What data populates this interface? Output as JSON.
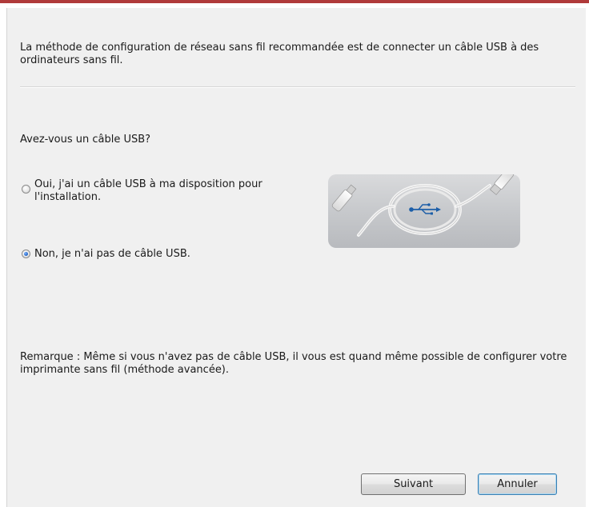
{
  "dialog": {
    "intro_text": "La méthode de configuration de réseau sans fil recommandée est de connecter un câble USB à des ordinateurs sans fil.",
    "question": "Avez-vous un câble USB?",
    "options": [
      {
        "label": "Oui, j'ai un câble USB à ma disposition pour l'installation.",
        "selected": false
      },
      {
        "label": "Non, je n'ai pas de câble USB.",
        "selected": true
      }
    ],
    "note": "Remarque :  Même si vous n'avez pas de câble USB, il vous est quand même possible de configurer votre imprimante sans fil (méthode avancée).",
    "image_icon": "usb-cable-illustration",
    "buttons": {
      "next_label": "Suivant",
      "cancel_label": "Annuler"
    }
  },
  "colors": {
    "title_accent": "#b03a3a",
    "background": "#f0f0f0",
    "radio_selected": "#1f5fc2",
    "default_button_border": "#3c7fb1"
  }
}
